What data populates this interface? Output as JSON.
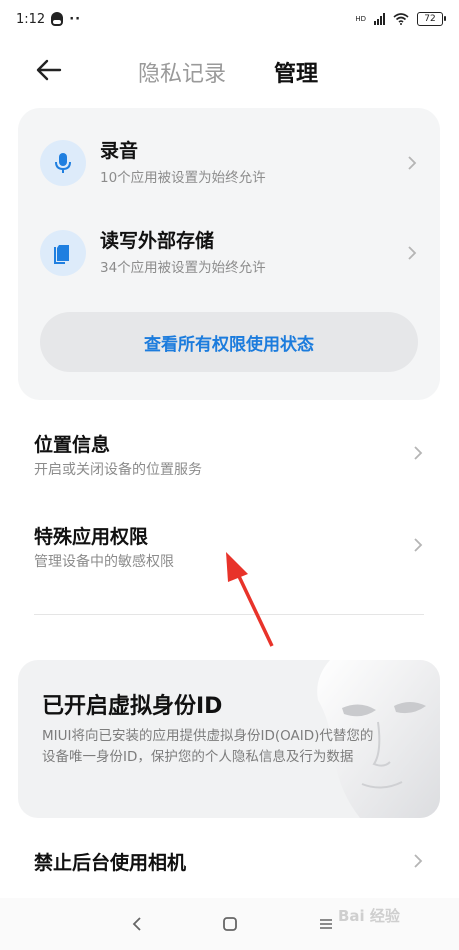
{
  "status_bar": {
    "time": "1:12",
    "dots": "··",
    "network": "HD",
    "battery": "72"
  },
  "header": {
    "tab_inactive": "隐私记录",
    "tab_active": "管理"
  },
  "permissions": [
    {
      "title": "录音",
      "subtitle": "10个应用被设置为始终允许",
      "icon": "microphone-icon"
    },
    {
      "title": "读写外部存储",
      "subtitle": "34个应用被设置为始终允许",
      "icon": "storage-icon"
    }
  ],
  "view_all_button": "查看所有权限使用状态",
  "menu": [
    {
      "title": "位置信息",
      "subtitle": "开启或关闭设备的位置服务"
    },
    {
      "title": "特殊应用权限",
      "subtitle": "管理设备中的敏感权限"
    }
  ],
  "virtual_id": {
    "title": "已开启虚拟身份ID",
    "description": "MIUI将向已安装的应用提供虚拟身份ID(OAID)代替您的设备唯一身份ID，保护您的个人隐私信息及行为数据"
  },
  "camera_row": {
    "title": "禁止后台使用相机"
  },
  "watermark": "Bai 经验",
  "colors": {
    "accent": "#1c7cdd",
    "annotation_arrow": "#e8332a"
  }
}
